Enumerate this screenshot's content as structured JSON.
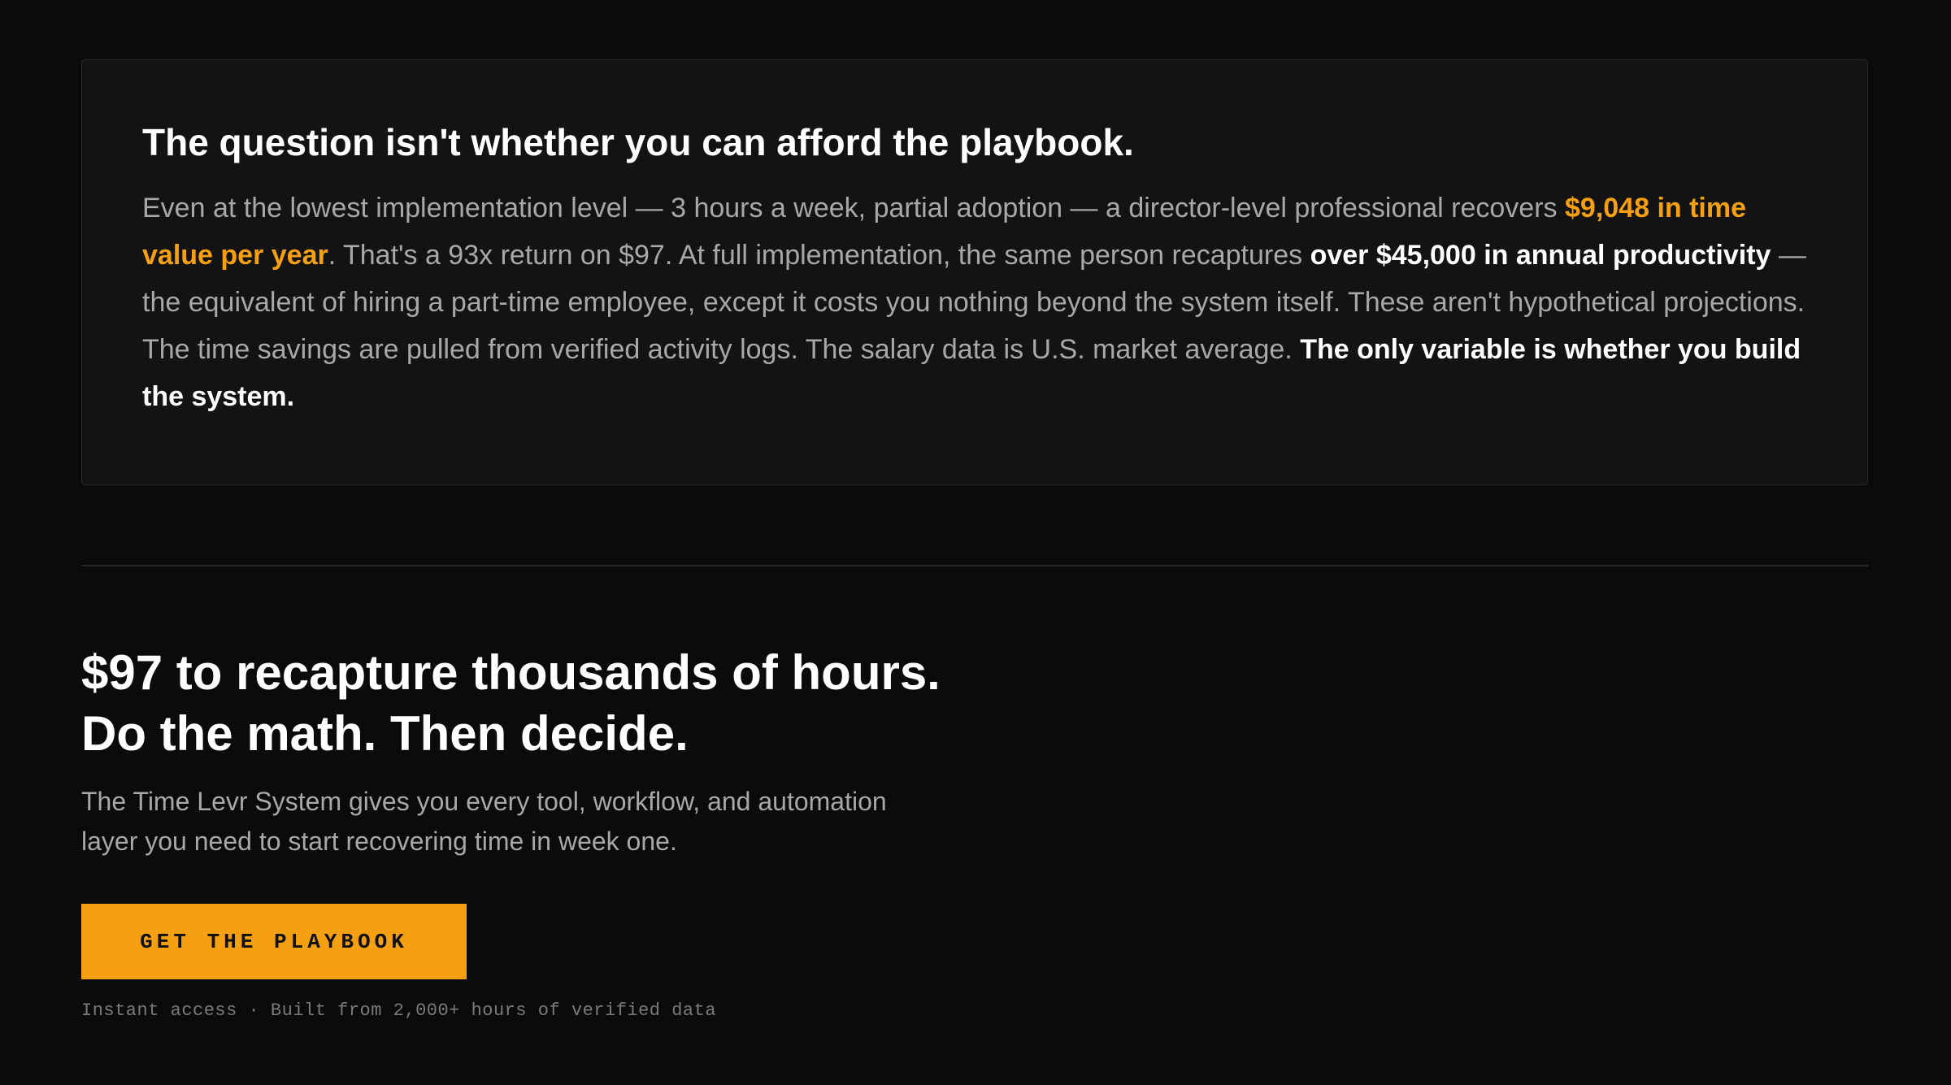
{
  "callout": {
    "title": "The question isn't whether you can afford the playbook.",
    "body": {
      "p1": "Even at the lowest implementation level — 3 hours a week, partial adoption — a director-level professional recovers ",
      "highlight1": "$9,048 in time value per year",
      "p2": ". That's a 93x return on $97. At full implementation, the same person recaptures ",
      "strong1": "over $45,000 in annual productivity",
      "p3": " — the equivalent of hiring a part-time employee, except it costs you nothing beyond the system itself. These aren't hypothetical projections. The time savings are pulled from verified activity logs. The salary data is U.S. market average. ",
      "strong2": "The only variable is whether you build the system."
    }
  },
  "cta": {
    "headline_line1": "$97 to recapture thousands of hours.",
    "headline_line2": "Do the math. Then decide.",
    "subtext": "The Time Levr System gives you every tool, workflow, and automation layer you need to start recovering time in week one.",
    "button_label": "GET THE PLAYBOOK",
    "note": "Instant access · Built from 2,000+ hours of verified data"
  },
  "colors": {
    "background": "#0b0b0b",
    "card": "#131313",
    "accent": "#f5a012",
    "muted_text": "#a8a8a8",
    "note_text": "#7a7a7a"
  }
}
